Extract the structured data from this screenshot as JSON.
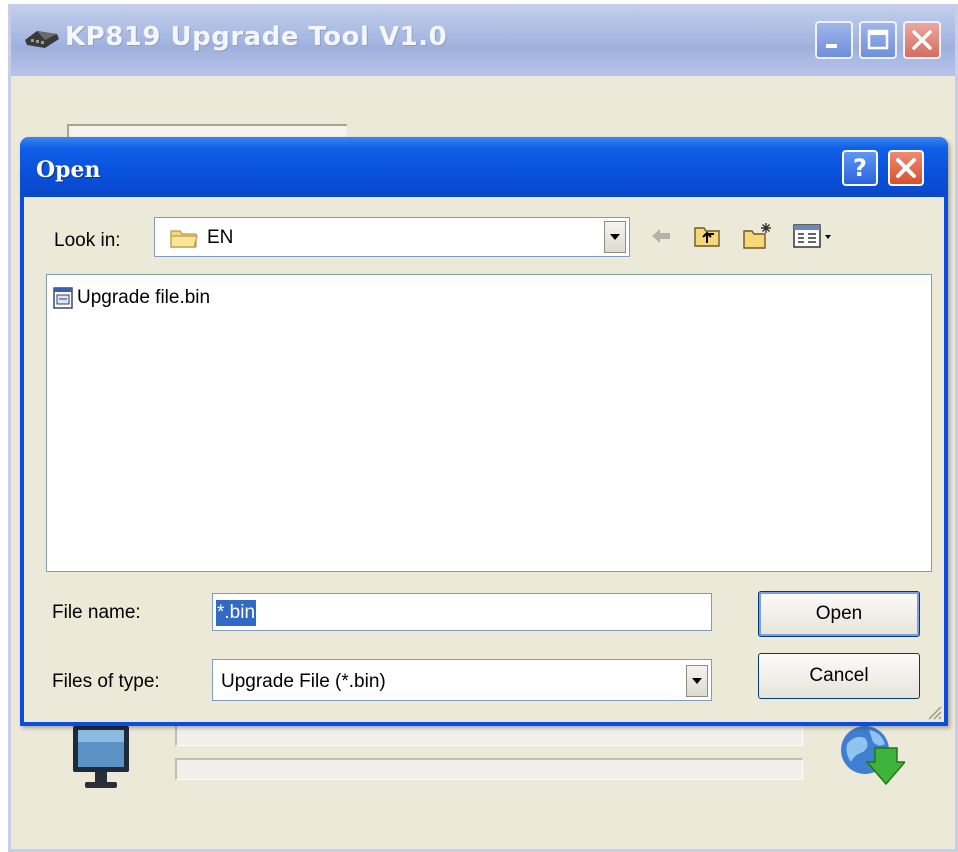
{
  "main_window": {
    "title": "KP819 Upgrade Tool V1.0",
    "icons": [
      "app-icon",
      "monitor-icon",
      "globe-download-icon",
      "minimize-icon",
      "maximize-icon",
      "close-icon"
    ]
  },
  "dialog": {
    "title": "Open",
    "help_glyph": "?",
    "look_in": {
      "label": "Look in:",
      "value": "EN",
      "icon": "folder-icon"
    },
    "toolbar": [
      "back-icon",
      "up-folder-icon",
      "new-folder-icon",
      "view-menu-icon"
    ],
    "files": [
      {
        "name": "Upgrade file.bin",
        "icon": "bin-file-icon"
      }
    ],
    "file_name": {
      "label": "File name:",
      "value": "*.bin"
    },
    "files_of_type": {
      "label": "Files of type:",
      "value": "Upgrade File (*.bin)"
    },
    "buttons": {
      "open": "Open",
      "cancel": "Cancel"
    }
  },
  "colors": {
    "dialog_title_blue": "#0a52dc",
    "window_face": "#ece9d8",
    "selection": "#316ac5",
    "close_red": "#d8502e"
  }
}
